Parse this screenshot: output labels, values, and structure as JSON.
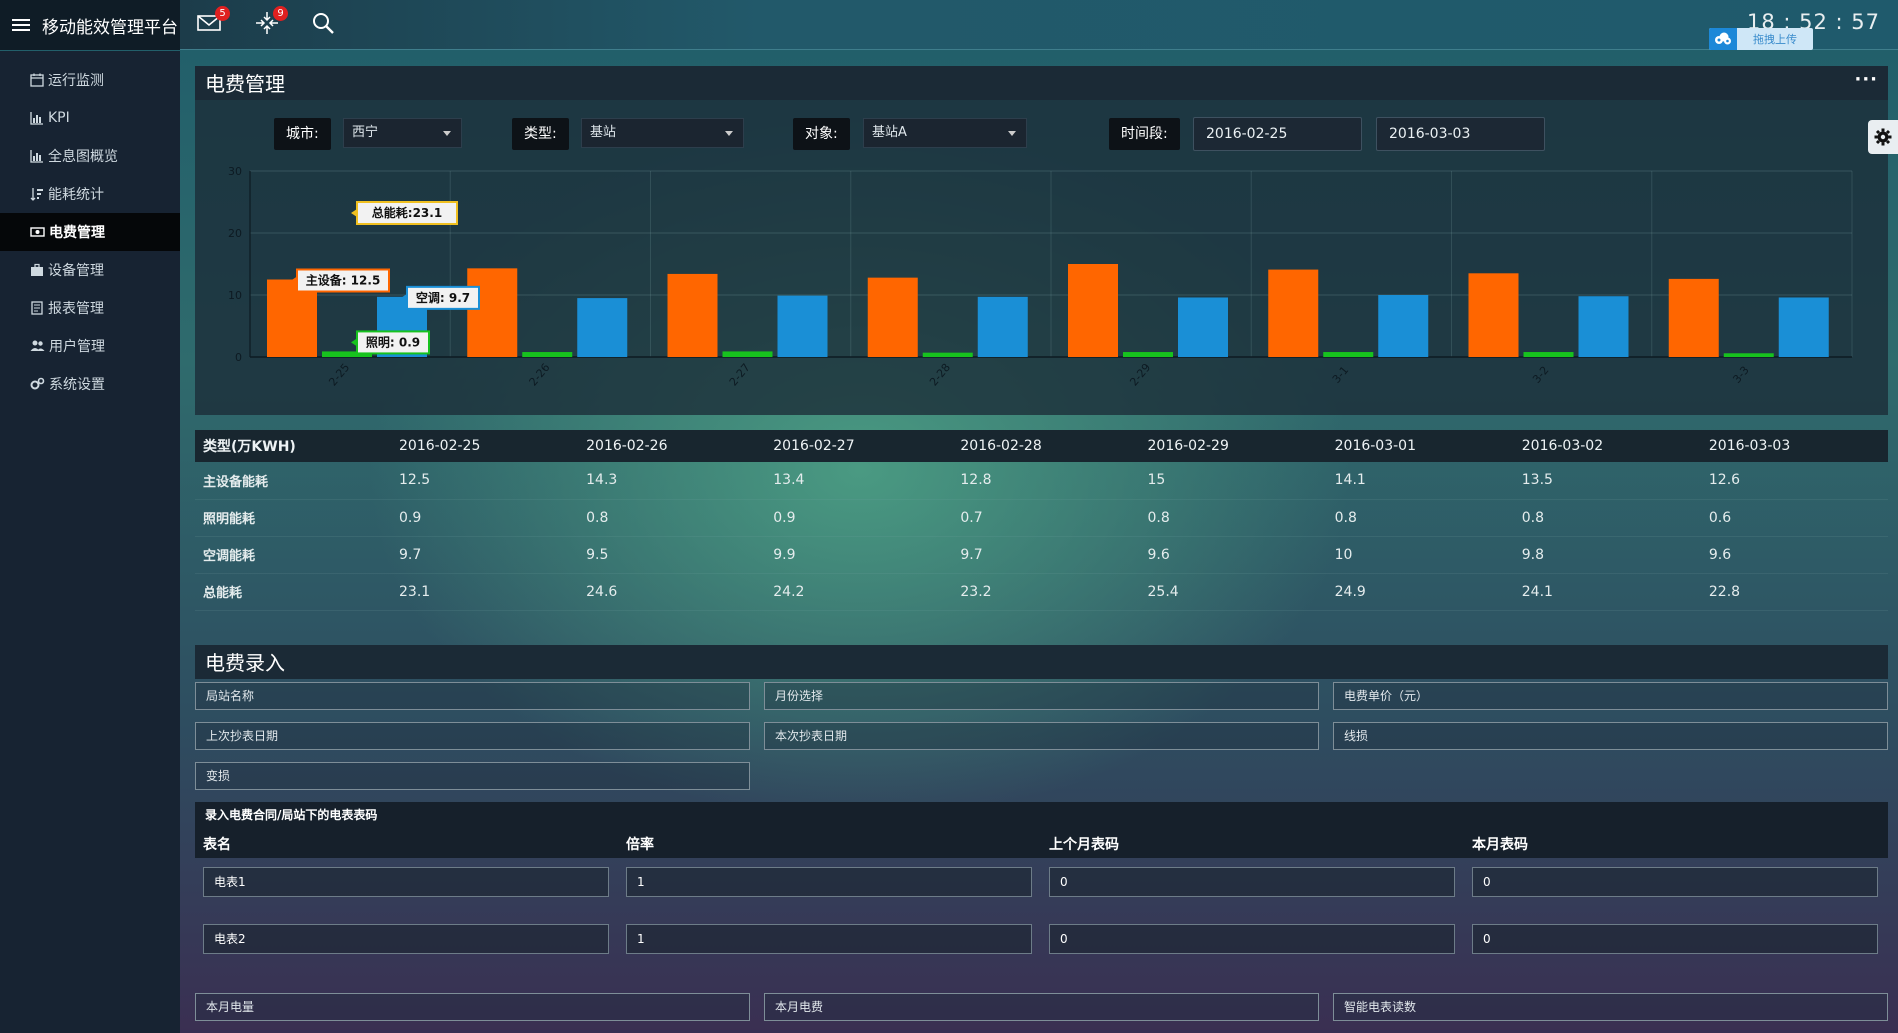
{
  "app": {
    "title": "移动能效管理平台",
    "mail_badge": "5",
    "alert_badge": "9",
    "clock": "18 : 52 : 57",
    "upload_label": "拖拽上传"
  },
  "sidebar": {
    "items": [
      {
        "label": "运行监测",
        "icon": "calendar-icon"
      },
      {
        "label": "KPI",
        "icon": "bar-chart-icon"
      },
      {
        "label": "全息图概览",
        "icon": "bar-chart-icon"
      },
      {
        "label": "能耗统计",
        "icon": "sort-bars-icon"
      },
      {
        "label": "电费管理",
        "icon": "money-icon",
        "active": true
      },
      {
        "label": "设备管理",
        "icon": "briefcase-icon"
      },
      {
        "label": "报表管理",
        "icon": "document-icon"
      },
      {
        "label": "用户管理",
        "icon": "users-icon"
      },
      {
        "label": "系统设置",
        "icon": "gears-icon"
      }
    ]
  },
  "billing": {
    "title": "电费管理",
    "filters": {
      "city_label": "城市:",
      "city_value": "西宁",
      "type_label": "类型:",
      "type_value": "基站",
      "object_label": "对象:",
      "object_value": "基站A",
      "period_label": "时间段:",
      "start_date": "2016-02-25",
      "end_date": "2016-03-03"
    }
  },
  "chart_data": {
    "type": "bar",
    "categories": [
      "2-25",
      "2-26",
      "2-27",
      "2-28",
      "2-29",
      "3-1",
      "3-2",
      "3-3"
    ],
    "series": [
      {
        "name": "主设备",
        "color": "#ff6600",
        "values": [
          12.5,
          14.3,
          13.4,
          12.8,
          15,
          14.1,
          13.5,
          12.6
        ]
      },
      {
        "name": "照明",
        "color": "#17c21e",
        "values": [
          0.9,
          0.8,
          0.9,
          0.7,
          0.8,
          0.8,
          0.8,
          0.6
        ]
      },
      {
        "name": "空调",
        "color": "#1a8fd6",
        "values": [
          9.7,
          9.5,
          9.9,
          9.7,
          9.6,
          10,
          9.8,
          9.6
        ]
      }
    ],
    "ylim": [
      0,
      30
    ],
    "yticks": [
      0,
      10,
      20,
      30
    ],
    "tooltip": {
      "category": "2-25",
      "total_label": "总能耗",
      "total_value": 23.1
    }
  },
  "table": {
    "headers": [
      "类型(万KWH)",
      "2016-02-25",
      "2016-02-26",
      "2016-02-27",
      "2016-02-28",
      "2016-02-29",
      "2016-03-01",
      "2016-03-02",
      "2016-03-03"
    ],
    "rows": [
      {
        "label": "主设备能耗",
        "values": [
          "12.5",
          "14.3",
          "13.4",
          "12.8",
          "15",
          "14.1",
          "13.5",
          "12.6"
        ]
      },
      {
        "label": "照明能耗",
        "values": [
          "0.9",
          "0.8",
          "0.9",
          "0.7",
          "0.8",
          "0.8",
          "0.8",
          "0.6"
        ]
      },
      {
        "label": "空调能耗",
        "values": [
          "9.7",
          "9.5",
          "9.9",
          "9.7",
          "9.6",
          "10",
          "9.8",
          "9.6"
        ]
      },
      {
        "label": "总能耗",
        "values": [
          "23.1",
          "24.6",
          "24.2",
          "23.2",
          "25.4",
          "24.9",
          "24.1",
          "22.8"
        ]
      }
    ]
  },
  "entry": {
    "title": "电费录入",
    "fields": {
      "station_name": "局站名称",
      "month_select": "月份选择",
      "unit_price": "电费单价（元）",
      "last_read_date": "上次抄表日期",
      "this_read_date": "本次抄表日期",
      "line_loss": "线损",
      "transformer_loss": "变损",
      "month_kwh": "本月电量",
      "month_fee": "本月电费",
      "smart_meter_reading": "智能电表读数"
    },
    "meters": {
      "title": "录入电费合同/局站下的电表表码",
      "columns": [
        "表名",
        "倍率",
        "上个月表码",
        "本月表码"
      ],
      "rows": [
        {
          "name": "电表1",
          "ratio": "1",
          "last": "0",
          "current": "0"
        },
        {
          "name": "电表2",
          "ratio": "1",
          "last": "0",
          "current": "0"
        }
      ]
    }
  }
}
